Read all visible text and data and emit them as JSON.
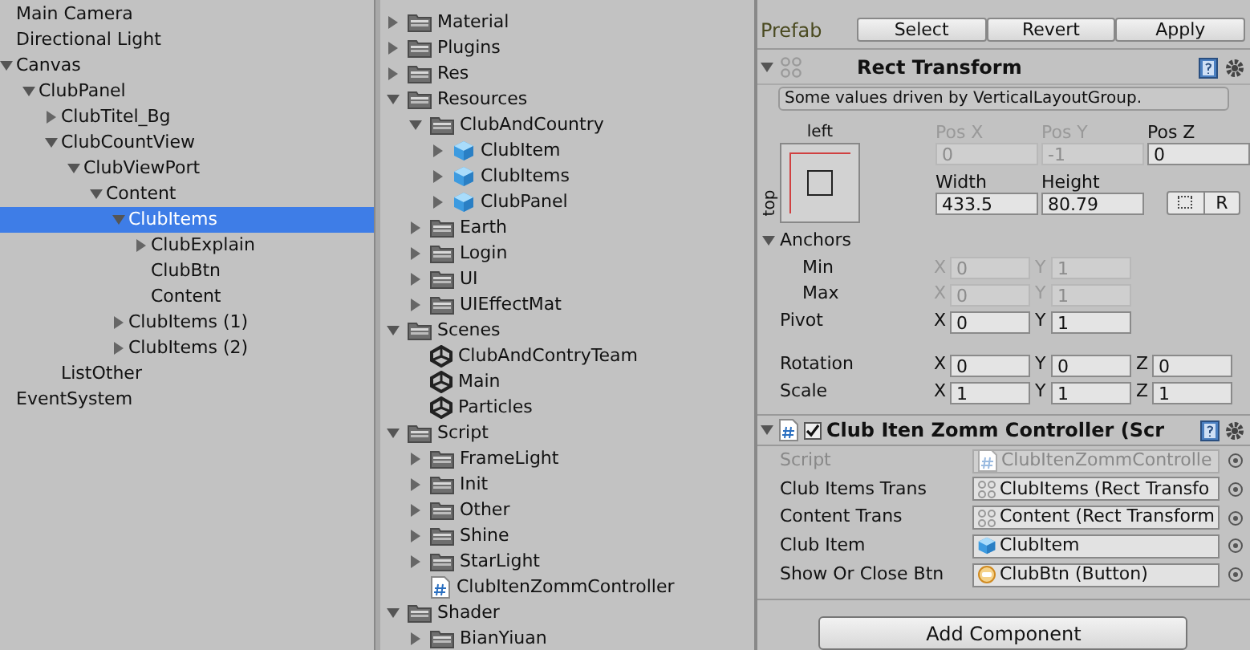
{
  "hierarchy": {
    "items": [
      {
        "label": "Main Camera",
        "selected": false
      },
      {
        "label": "Directional Light",
        "selected": false
      },
      {
        "label": "Canvas",
        "selected": false,
        "expanded": true,
        "children": [
          {
            "label": "ClubPanel",
            "selected": false,
            "expanded": true,
            "children": [
              {
                "label": "ClubTitel_Bg",
                "selected": false,
                "expanded": false
              },
              {
                "label": "ClubCountView",
                "selected": false,
                "expanded": true,
                "children": [
                  {
                    "label": "ClubViewPort",
                    "selected": false,
                    "expanded": true,
                    "children": [
                      {
                        "label": "Content",
                        "selected": false,
                        "expanded": true,
                        "children": [
                          {
                            "label": "ClubItems",
                            "selected": true,
                            "expanded": true,
                            "children": [
                              {
                                "label": "ClubExplain",
                                "selected": false,
                                "expanded": false
                              },
                              {
                                "label": "ClubBtn",
                                "selected": false
                              },
                              {
                                "label": "Content",
                                "selected": false
                              }
                            ]
                          },
                          {
                            "label": "ClubItems (1)",
                            "selected": false,
                            "expanded": false
                          },
                          {
                            "label": "ClubItems (2)",
                            "selected": false,
                            "expanded": false
                          }
                        ]
                      }
                    ]
                  }
                ]
              },
              {
                "label": "ListOther",
                "selected": false
              }
            ]
          }
        ]
      },
      {
        "label": "EventSystem",
        "selected": false
      }
    ]
  },
  "project": {
    "items": [
      {
        "label": "Material",
        "kind": "folder",
        "expanded": false
      },
      {
        "label": "Plugins",
        "kind": "folder",
        "expanded": false
      },
      {
        "label": "Res",
        "kind": "folder",
        "expanded": false
      },
      {
        "label": "Resources",
        "kind": "folder",
        "expanded": true,
        "children": [
          {
            "label": "ClubAndCountry",
            "kind": "folder",
            "expanded": true,
            "children": [
              {
                "label": "ClubItem",
                "kind": "prefab",
                "expanded": false
              },
              {
                "label": "ClubItems",
                "kind": "prefab",
                "expanded": false
              },
              {
                "label": "ClubPanel",
                "kind": "prefab",
                "expanded": false
              }
            ]
          },
          {
            "label": "Earth",
            "kind": "folder",
            "expanded": false
          },
          {
            "label": "Login",
            "kind": "folder",
            "expanded": false
          },
          {
            "label": "UI",
            "kind": "folder",
            "expanded": false
          },
          {
            "label": "UIEffectMat",
            "kind": "folder",
            "expanded": false
          }
        ]
      },
      {
        "label": "Scenes",
        "kind": "folder",
        "expanded": true,
        "children": [
          {
            "label": "ClubAndContryTeam",
            "kind": "scene"
          },
          {
            "label": "Main",
            "kind": "scene"
          },
          {
            "label": "Particles",
            "kind": "scene"
          }
        ]
      },
      {
        "label": "Script",
        "kind": "folder",
        "expanded": true,
        "children": [
          {
            "label": "FrameLight",
            "kind": "folder",
            "expanded": false
          },
          {
            "label": "Init",
            "kind": "folder",
            "expanded": false
          },
          {
            "label": "Other",
            "kind": "folder",
            "expanded": false
          },
          {
            "label": "Shine",
            "kind": "folder",
            "expanded": false
          },
          {
            "label": "StarLight",
            "kind": "folder",
            "expanded": false
          },
          {
            "label": "ClubItenZommController",
            "kind": "script"
          }
        ]
      },
      {
        "label": "Shader",
        "kind": "folder",
        "expanded": true,
        "children": [
          {
            "label": "BianYiuan",
            "kind": "folder",
            "expanded": false
          }
        ]
      }
    ]
  },
  "inspector": {
    "prefab": {
      "label": "Prefab",
      "buttons": [
        "Select",
        "Revert",
        "Apply"
      ]
    },
    "rect_transform": {
      "title": "Rect Transform",
      "expanded": true,
      "note": "Some values driven by VerticalLayoutGroup.",
      "anchor_h": "left",
      "anchor_v": "top",
      "pos": [
        {
          "label": "Pos X",
          "value": "0",
          "disabled": true
        },
        {
          "label": "Pos Y",
          "value": "-1",
          "disabled": true
        },
        {
          "label": "Pos Z",
          "value": "0",
          "disabled": false
        }
      ],
      "size": [
        {
          "label": "Width",
          "value": "433.5",
          "disabled": false
        },
        {
          "label": "Height",
          "value": "80.79",
          "disabled": false
        }
      ],
      "raw_button": "R",
      "anchors": {
        "label": "Anchors",
        "expanded": true,
        "rows": [
          {
            "label": "Min",
            "disabled": true,
            "fields": [
              {
                "axis": "X",
                "value": "0"
              },
              {
                "axis": "Y",
                "value": "1"
              }
            ]
          },
          {
            "label": "Max",
            "disabled": true,
            "fields": [
              {
                "axis": "X",
                "value": "0"
              },
              {
                "axis": "Y",
                "value": "1"
              }
            ]
          }
        ]
      },
      "rows": [
        {
          "label": "Pivot",
          "disabled": false,
          "fields": [
            {
              "axis": "X",
              "value": "0"
            },
            {
              "axis": "Y",
              "value": "1"
            }
          ]
        },
        {
          "label": "Rotation",
          "disabled": false,
          "fields": [
            {
              "axis": "X",
              "value": "0"
            },
            {
              "axis": "Y",
              "value": "0"
            },
            {
              "axis": "Z",
              "value": "0"
            }
          ]
        },
        {
          "label": "Scale",
          "disabled": false,
          "fields": [
            {
              "axis": "X",
              "value": "1"
            },
            {
              "axis": "Y",
              "value": "1"
            },
            {
              "axis": "Z",
              "value": "1"
            }
          ]
        }
      ]
    },
    "component": {
      "title": "Club Iten Zomm Controller (Scr",
      "enabled": true,
      "expanded": true,
      "fields": [
        {
          "label": "Script",
          "value": "ClubItenZommControlle",
          "kind": "script",
          "disabled": true
        },
        {
          "label": "Club Items Trans",
          "value": "ClubItems (Rect Transfo",
          "kind": "rect",
          "disabled": false
        },
        {
          "label": "Content Trans",
          "value": "Content (Rect Transform",
          "kind": "rect",
          "disabled": false
        },
        {
          "label": "Club Item",
          "value": "ClubItem",
          "kind": "prefab",
          "disabled": false
        },
        {
          "label": "Show Or Close Btn",
          "value": "ClubBtn (Button)",
          "kind": "button",
          "disabled": false
        }
      ]
    },
    "add_component": "Add Component"
  }
}
